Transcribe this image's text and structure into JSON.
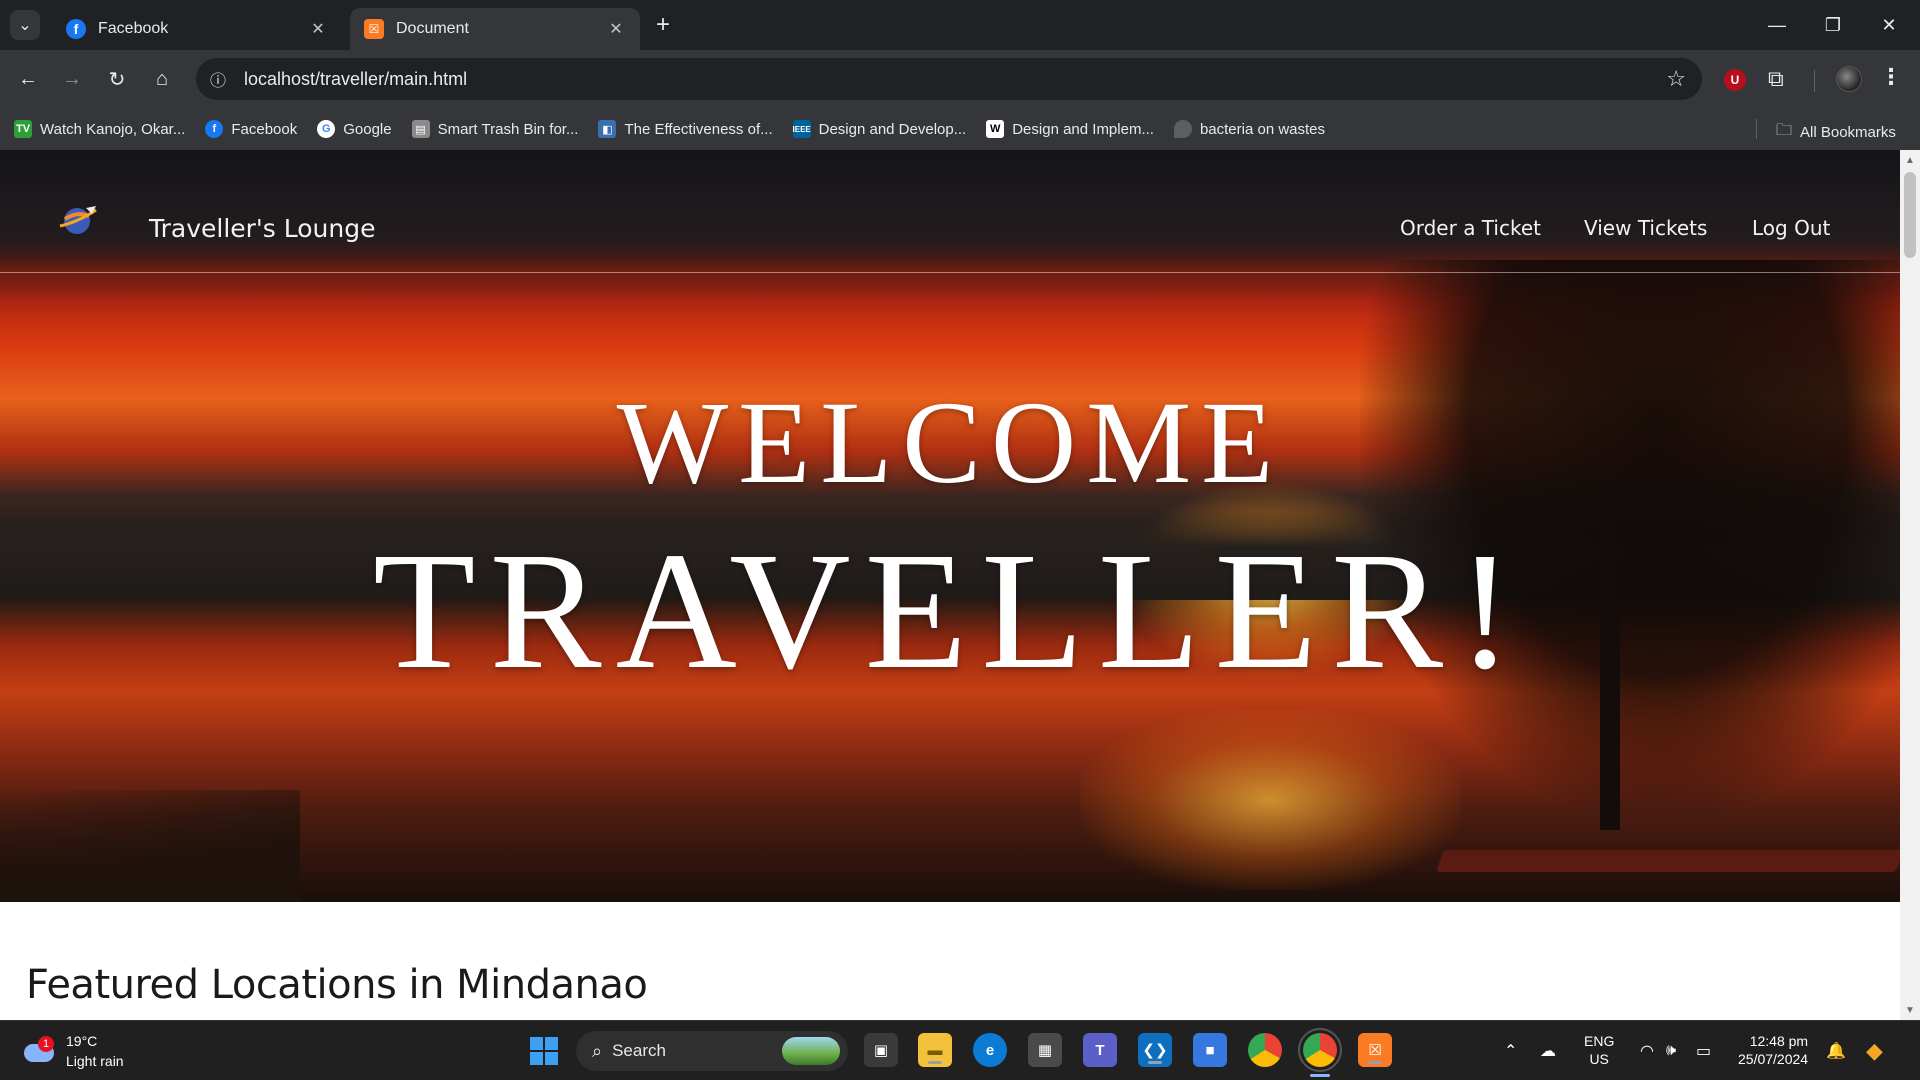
{
  "browser": {
    "tabs": [
      {
        "title": "Facebook",
        "icon": "facebook-icon",
        "active": false
      },
      {
        "title": "Document",
        "icon": "xampp-icon",
        "active": true
      }
    ],
    "url": "localhost/traveller/main.html",
    "bookmarks": [
      {
        "label": "Watch Kanojo, Okar...",
        "icon": "tv-icon"
      },
      {
        "label": "Facebook",
        "icon": "facebook-icon"
      },
      {
        "label": "Google",
        "icon": "google-icon"
      },
      {
        "label": "Smart Trash Bin for...",
        "icon": "document-icon"
      },
      {
        "label": "The Effectiveness of...",
        "icon": "journal-icon"
      },
      {
        "label": "Design and Develop...",
        "icon": "ieee-icon"
      },
      {
        "label": "Design and Implem...",
        "icon": "wikipedia-icon"
      },
      {
        "label": "bacteria on wastes",
        "icon": "leaf-icon"
      }
    ],
    "all_bookmarks": "All Bookmarks"
  },
  "site": {
    "brand": "Traveller's Lounge",
    "nav": [
      "Order a Ticket",
      "View Tickets",
      "Log Out"
    ],
    "hero_line1": "WELCOME",
    "hero_line2": "TRAVELLER!",
    "section_title": "Featured Locations in Mindanao"
  },
  "taskbar": {
    "weather_temp": "19°C",
    "weather_desc": "Light rain",
    "weather_badge": "1",
    "search_label": "Search",
    "lang_line1": "ENG",
    "lang_line2": "US",
    "time": "12:48 pm",
    "date": "25/07/2024"
  },
  "colors": {
    "browser_bg": "#202124",
    "toolbar_bg": "#35363a",
    "taskbar_bg": "#202020",
    "facebook_blue": "#1877f2",
    "xampp_orange": "#fb7a24"
  }
}
